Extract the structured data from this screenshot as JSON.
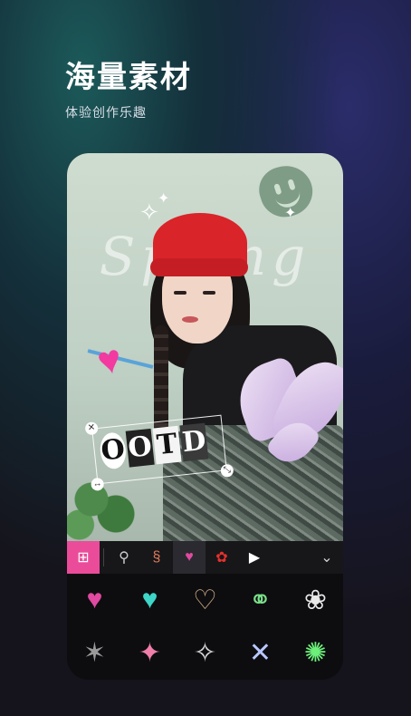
{
  "header": {
    "title": "海量素材",
    "subtitle": "体验创作乐趣"
  },
  "canvas": {
    "background_text": "Spring",
    "sticker_text": [
      "O",
      "O",
      "T",
      "D"
    ]
  },
  "toolbar": {
    "items": [
      {
        "name": "add-sticker",
        "glyph": "⊞"
      },
      {
        "name": "sticker-cat-1",
        "glyph": "⚲"
      },
      {
        "name": "sticker-cat-2",
        "glyph": "§"
      },
      {
        "name": "sticker-cat-hearts",
        "glyph": "♥"
      },
      {
        "name": "sticker-cat-flower",
        "glyph": "✿"
      },
      {
        "name": "sticker-cat-play",
        "glyph": "▶"
      }
    ],
    "expand_glyph": "⌄"
  },
  "stickers": [
    {
      "glyph": "♥",
      "color": "#e04aa0"
    },
    {
      "glyph": "♥",
      "color": "#3dd6c8"
    },
    {
      "glyph": "♡",
      "color": "#d6b08a"
    },
    {
      "glyph": "⚭",
      "color": "#7be08a"
    },
    {
      "glyph": "❀",
      "color": "#e8e8e8"
    },
    {
      "glyph": "✶",
      "color": "#9a9a9a"
    },
    {
      "glyph": "✦",
      "color": "#f07ea8"
    },
    {
      "glyph": "✧",
      "color": "#dcdcdc"
    },
    {
      "glyph": "✕",
      "color": "#b8c8ff"
    },
    {
      "glyph": "✺",
      "color": "#6cf07a"
    }
  ],
  "colors": {
    "accent": "#ea4c9a",
    "beanie": "#d9242a"
  }
}
